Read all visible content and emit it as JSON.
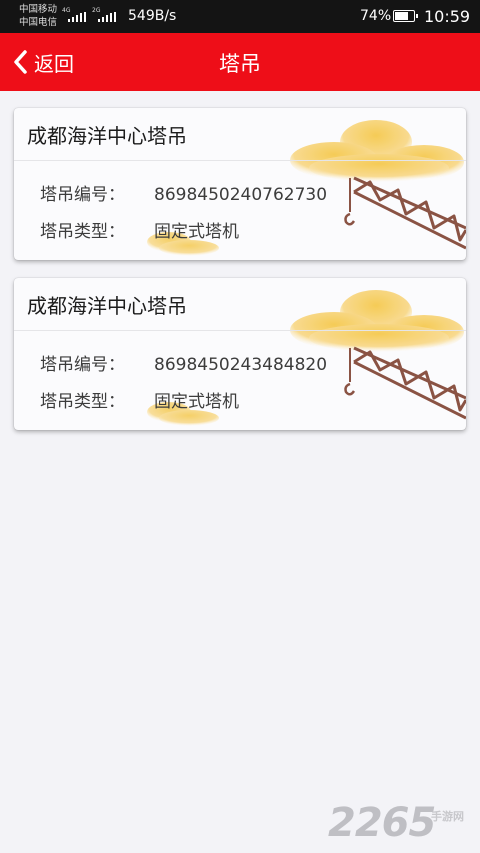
{
  "status_bar": {
    "carrier_1": "中国移动",
    "carrier_2": "中国电信",
    "signal_1_tag": "4G",
    "signal_2_tag": "2G",
    "net_speed": "549B/s",
    "battery_percent": "74%",
    "battery_level": 0.74,
    "time": "10:59"
  },
  "header": {
    "back_label": "返回",
    "title": "塔吊",
    "background_color": "#ee0e18"
  },
  "cards": [
    {
      "title": "成都海洋中心塔吊",
      "number_label": "塔吊编号：",
      "number_value": "8698450240762730",
      "type_label": "塔吊类型：",
      "type_value": "固定式塔机"
    },
    {
      "title": "成都海洋中心塔吊",
      "number_label": "塔吊编号：",
      "number_value": "8698450243484820",
      "type_label": "塔吊类型：",
      "type_value": "固定式塔机"
    }
  ],
  "watermark": {
    "number": "2265",
    "text": "手游网"
  },
  "colors": {
    "accent": "#ee0e18",
    "cloud": "#f5c94e",
    "crane": "#8a5344"
  }
}
